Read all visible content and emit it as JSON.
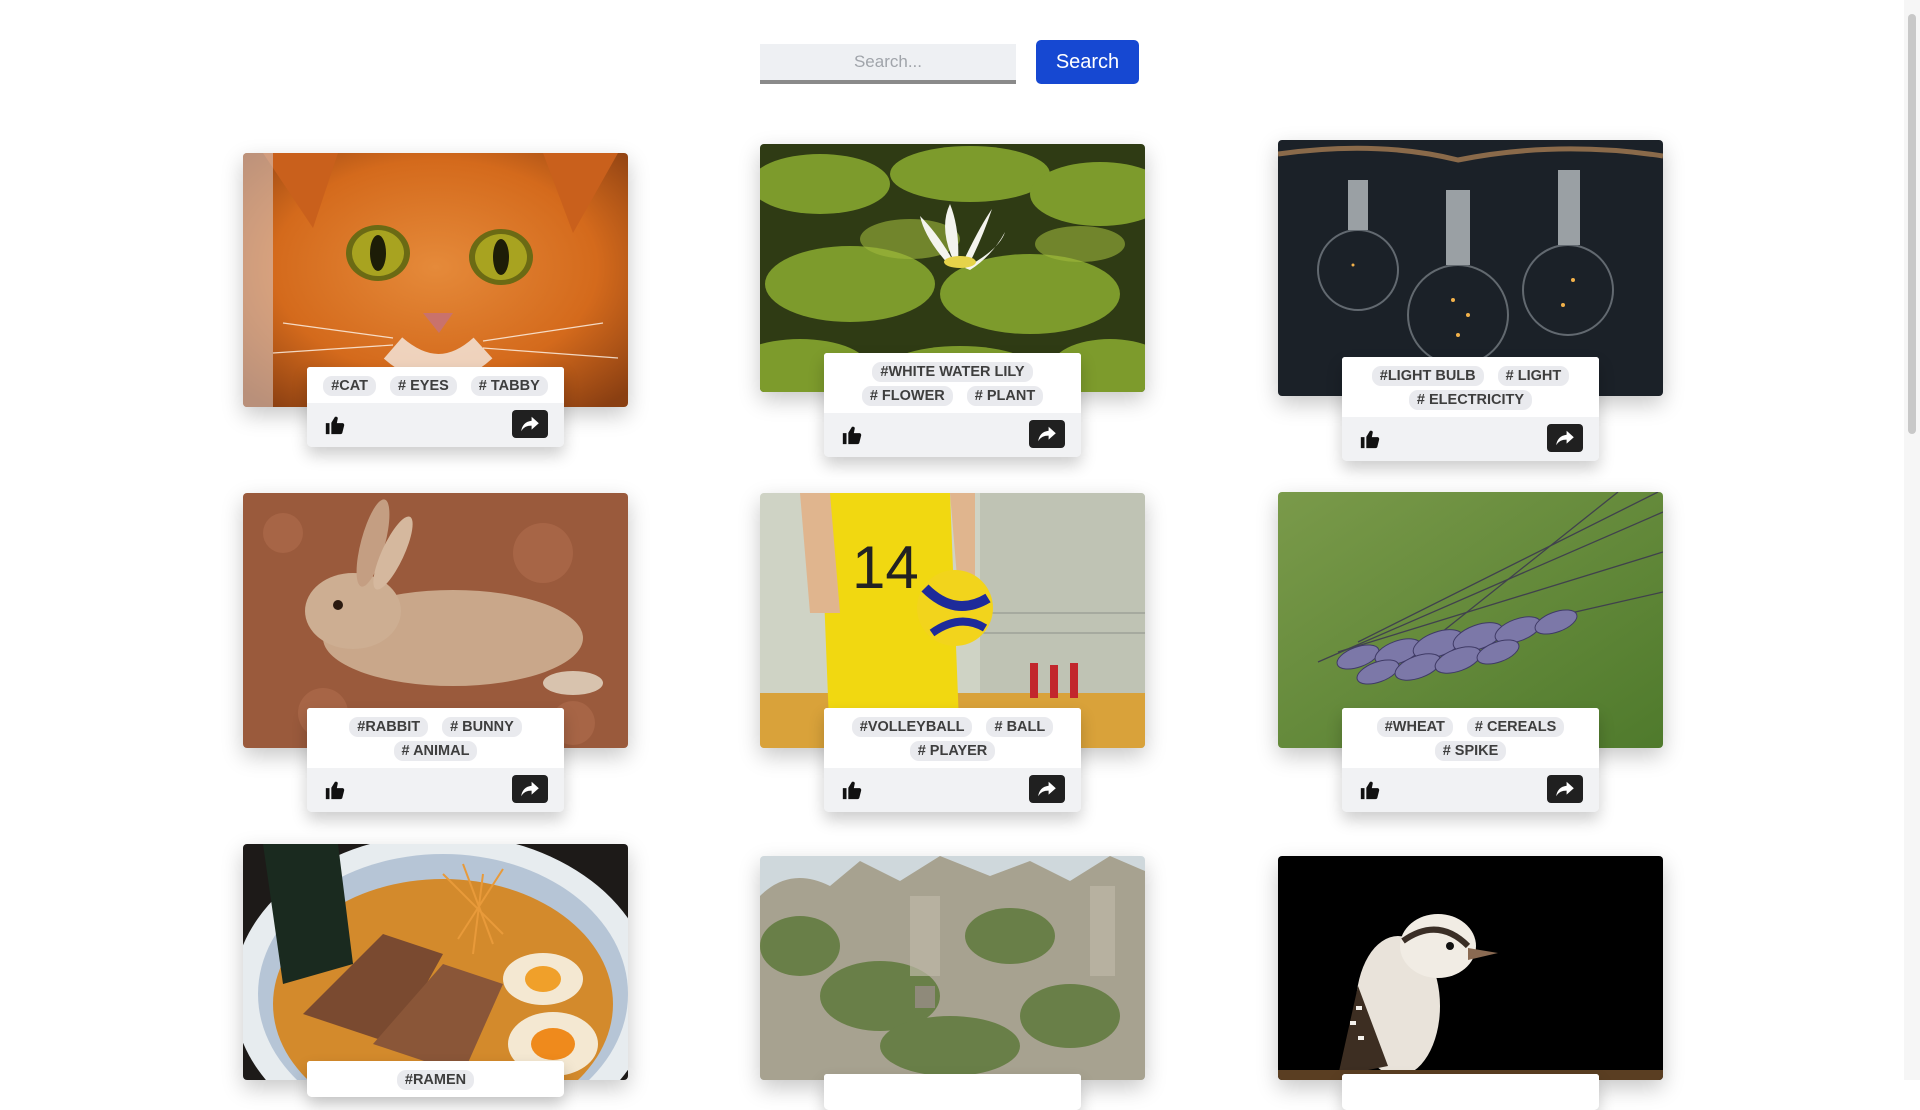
{
  "search": {
    "placeholder": "Search...",
    "value": "",
    "button_label": "Search"
  },
  "colors": {
    "accent": "#1648d2",
    "tag_background": "#e9eaee",
    "share_button": "#202020"
  },
  "icons": {
    "like": "thumbs-up-icon",
    "share": "share-arrow-icon"
  },
  "cards": [
    {
      "photo": "orange tabby cat with green eyes",
      "tags": [
        "#CAT",
        "# EYES",
        "# TABBY"
      ]
    },
    {
      "photo": "white water lily among lily pads",
      "tags": [
        "#WHITE WATER LILY",
        "# FLOWER",
        "# PLANT"
      ]
    },
    {
      "photo": "hanging light bulbs on a dark background",
      "tags": [
        "#LIGHT BULB",
        "# LIGHT",
        "# ELECTRICITY"
      ]
    },
    {
      "photo": "brown rabbit lying on soil",
      "tags": [
        "#RABBIT",
        "# BUNNY",
        "# ANIMAL"
      ]
    },
    {
      "photo": "volleyball player in yellow jersey number 14",
      "tags": [
        "#VOLLEYBALL",
        "# BALL",
        "# PLAYER"
      ]
    },
    {
      "photo": "close-up of a wheat ear on green background",
      "tags": [
        "#WHEAT",
        "# CEREALS",
        "# SPIKE"
      ]
    },
    {
      "photo": "bowl of ramen with eggs and pork",
      "tags": [
        "#RAMEN"
      ]
    },
    {
      "photo": "limestone cliffs with green vegetation",
      "tags": []
    },
    {
      "photo": "kookaburra on a branch against black",
      "tags": []
    }
  ]
}
